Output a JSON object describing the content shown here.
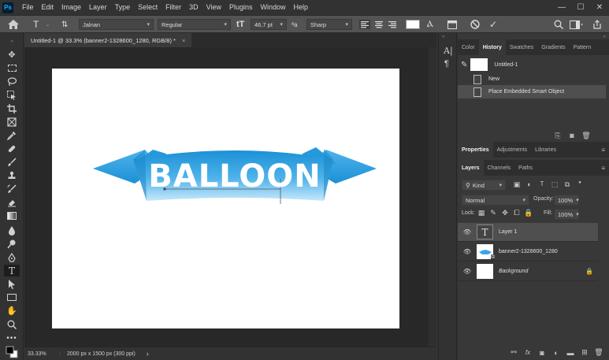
{
  "app": {
    "logo": "Ps"
  },
  "menu": [
    "File",
    "Edit",
    "Image",
    "Layer",
    "Type",
    "Select",
    "Filter",
    "3D",
    "View",
    "Plugins",
    "Window",
    "Help"
  ],
  "window_controls": {
    "minimize": "—",
    "maximize": "☐",
    "close": "✕"
  },
  "options": {
    "font_family": "Jalnan",
    "font_style": "Regular",
    "font_size": "46.7 pt",
    "antialias": "Sharp",
    "text_color": "#ffffff"
  },
  "document": {
    "tab_title": "Untitled-1 @ 33.3% (banner2-1328600_1280, RGB/8) *",
    "close": "×",
    "zoom": "33.33%",
    "info": "2000 px x 1500 px (300 ppi)",
    "info_arrow": "›"
  },
  "banner": {
    "text": "BALLOON",
    "colors": {
      "dark": "#1b90d6",
      "mid": "#4fb3ea",
      "light": "#c7e8fb"
    }
  },
  "panels": {
    "top_tabs": [
      "Color",
      "History",
      "Swatches",
      "Gradients",
      "Pattern"
    ],
    "top_active": "History",
    "history": {
      "snapshot": "Untitled-1",
      "items": [
        "New",
        "Place Embedded Smart Object"
      ]
    },
    "mid_tabs": [
      "Properties",
      "Adjustments",
      "Libraries"
    ],
    "mid_active": "Properties",
    "layer_tabs": [
      "Layers",
      "Channels",
      "Paths"
    ],
    "layer_active": "Layers",
    "filter_kind": "Kind",
    "blend_mode": "Normal",
    "opacity_label": "Opacity:",
    "opacity_value": "100%",
    "lock_label": "Lock:",
    "fill_label": "Fill:",
    "fill_value": "100%",
    "layers": [
      {
        "name": "Layer 1",
        "type": "text"
      },
      {
        "name": "banner2-1328600_1280",
        "type": "smart"
      },
      {
        "name": "Background",
        "type": "background"
      }
    ]
  }
}
